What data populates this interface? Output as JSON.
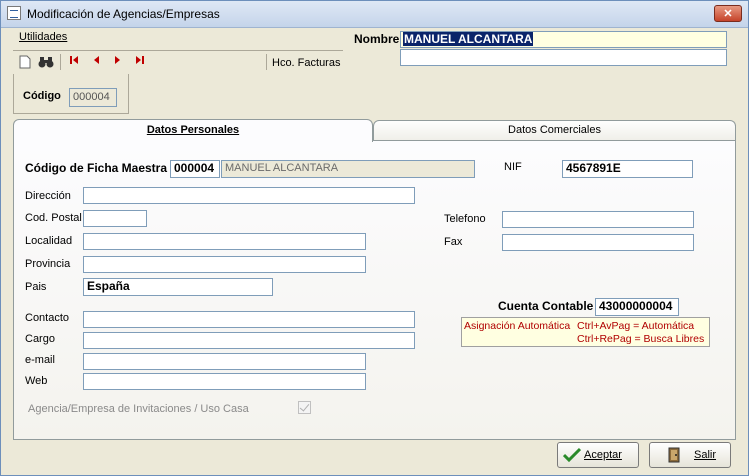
{
  "window": {
    "title": "Modificación de Agencias/Empresas",
    "close": "✕"
  },
  "menu": {
    "utilidades": "Utilidades"
  },
  "toolbar": {
    "hco_facturas": "Hco. Facturas"
  },
  "nombre": {
    "label": "Nombre",
    "value": "MANUEL ALCANTARA"
  },
  "codigo": {
    "label": "Código",
    "value": "000004"
  },
  "tabs": [
    {
      "label": "Datos Personales"
    },
    {
      "label": "Datos Comerciales"
    }
  ],
  "form": {
    "ficha_label": "Código de Ficha Maestra",
    "ficha_code": "000004",
    "ficha_name": "MANUEL ALCANTARA",
    "nif_label": "NIF",
    "nif_value": "4567891E",
    "direccion_label": "Dirección",
    "cod_postal_label": "Cod. Postal",
    "localidad_label": "Localidad",
    "provincia_label": "Provincia",
    "pais_label": "Pais",
    "pais_value": "España",
    "telefono_label": "Telefono",
    "fax_label": "Fax",
    "contacto_label": "Contacto",
    "cargo_label": "Cargo",
    "email_label": "e-mail",
    "web_label": "Web",
    "cuenta_label": "Cuenta Contable",
    "cuenta_value": "43000000004",
    "hint_l1": "Asignación Automática",
    "hint_r1": "Ctrl+AvPag = Automática",
    "hint_r2": "Ctrl+RePag = Busca Libres",
    "invitaciones_label": "Agencia/Empresa de Invitaciones / Uso Casa"
  },
  "buttons": {
    "aceptar": "Aceptar",
    "salir": "Salir"
  }
}
